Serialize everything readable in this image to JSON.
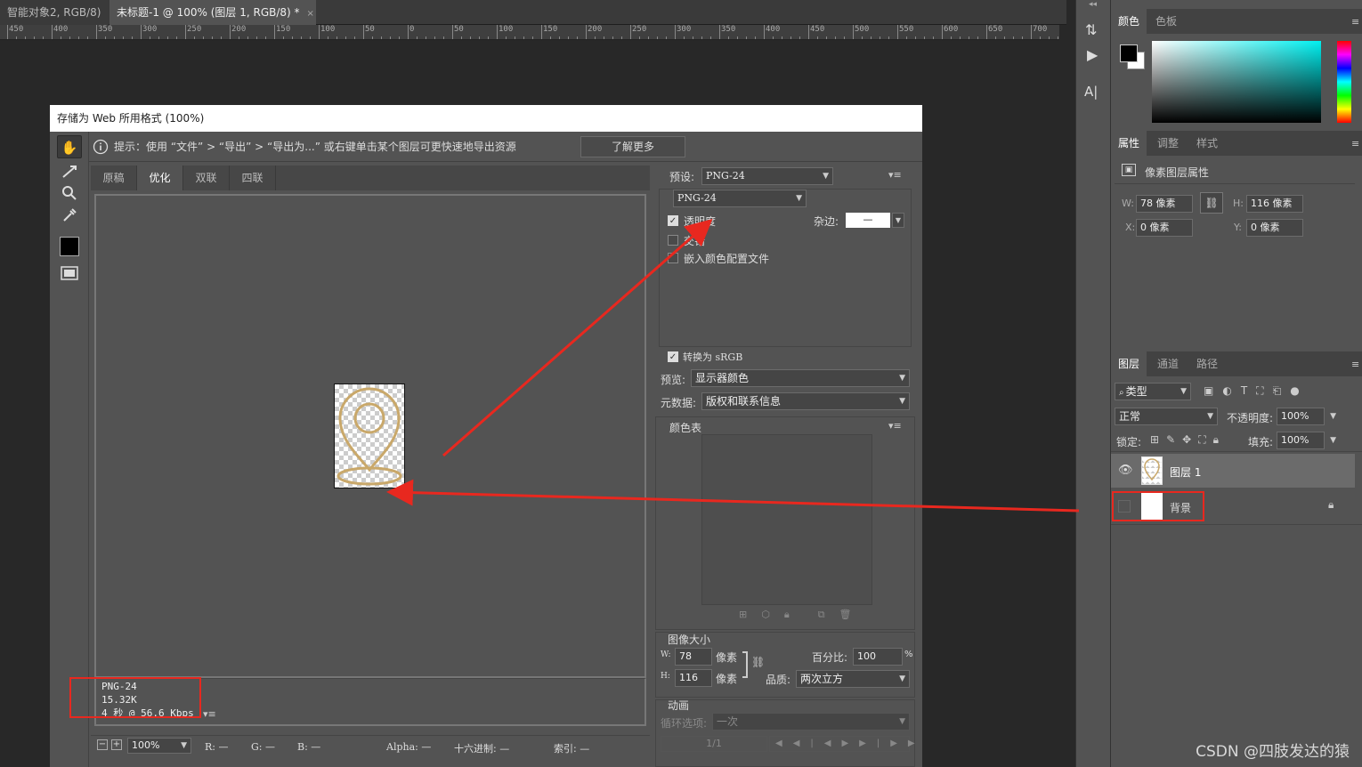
{
  "doc_tabs": [
    {
      "label": "智能对象2, RGB/8)",
      "close": "×"
    },
    {
      "label": "未标题-1 @ 100% (图层 1, RGB/8) *",
      "close": "×"
    }
  ],
  "ruler_ticks": [
    "450",
    "400",
    "350",
    "300",
    "250",
    "200",
    "150",
    "100",
    "50",
    "0",
    "50",
    "100",
    "150",
    "200",
    "250",
    "300",
    "350",
    "400",
    "450",
    "500",
    "550",
    "600",
    "650",
    "700"
  ],
  "dialog": {
    "title": "存储为 Web 所用格式 (100%)",
    "hint": "提示：使用 “文件” > “导出” > “导出为...” 或右键单击某个图层可更快速地导出资源",
    "learn_more": "了解更多",
    "view_tabs": [
      "原稿",
      "优化",
      "双联",
      "四联"
    ],
    "active_view_tab": "优化",
    "info": {
      "format": "PNG-24",
      "size": "15.32K",
      "speed": "4 秒 @ 56.6 Kbps"
    },
    "status": {
      "zoom": "100%",
      "r": "R: —",
      "g": "G: —",
      "b": "B: —",
      "alpha": "Alpha: —",
      "hex": "十六进制: —",
      "index": "索引: —"
    },
    "settings": {
      "preset_label": "预设:",
      "preset_value": "PNG-24",
      "format_value": "PNG-24",
      "transparency_label": "透明度",
      "transparency_checked": true,
      "matte_label": "杂边:",
      "matte_value": "—",
      "interlaced_label": "交错",
      "interlaced_checked": false,
      "embed_profile_label": "嵌入颜色配置文件",
      "embed_profile_checked": false,
      "convert_srgb_label": "转换为 sRGB",
      "convert_srgb_checked": true,
      "preview_label": "预览:",
      "preview_value": "显示器颜色",
      "metadata_label": "元数据:",
      "metadata_value": "版权和联系信息",
      "color_table_label": "颜色表",
      "image_size_label": "图像大小",
      "w_label": "W:",
      "w_value": "78",
      "h_label": "H:",
      "h_value": "116",
      "px_unit": "像素",
      "percent_label": "百分比:",
      "percent_value": "100",
      "percent_unit": "%",
      "quality_label": "品质:",
      "quality_value": "两次立方",
      "animation_label": "动画",
      "loop_label": "循环选项:",
      "loop_value": "一次",
      "frame_counter": "1/1"
    }
  },
  "panels": {
    "color_tabs": [
      "颜色",
      "色板"
    ],
    "props_tabs": [
      "属性",
      "调整",
      "样式"
    ],
    "pixel_layer_props": "像素图层属性",
    "w_label": "W:",
    "w_value": "78 像素",
    "h_label": "H:",
    "h_value": "116 像素",
    "x_label": "X:",
    "x_value": "0 像素",
    "y_label": "Y:",
    "y_value": "0 像素",
    "layers_tabs": [
      "图层",
      "通道",
      "路径"
    ],
    "filter_kind": "类型",
    "blend_mode": "正常",
    "opacity_label": "不透明度:",
    "opacity_value": "100%",
    "lock_label": "锁定:",
    "fill_label": "填充:",
    "fill_value": "100%",
    "layers": [
      {
        "name": "图层 1"
      },
      {
        "name": "背景"
      }
    ]
  },
  "watermark": "CSDN @四肢发达的猿",
  "colors": {
    "annotation_red": "#e8281f",
    "pin_gold": "#c9a86a"
  }
}
